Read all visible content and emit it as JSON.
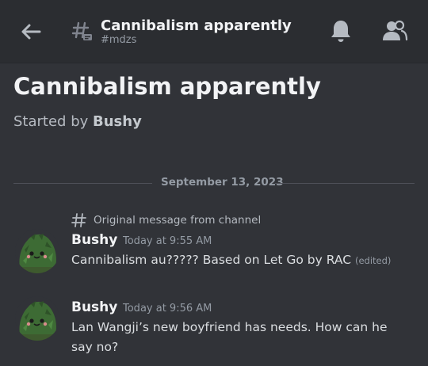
{
  "header": {
    "title": "Cannibalism apparently",
    "channel": "#mdzs",
    "icons": [
      "back-arrow-icon",
      "thread-icon",
      "bell-icon",
      "members-icon"
    ]
  },
  "thread": {
    "title": "Cannibalism apparently",
    "started_prefix": "Started by",
    "started_by": "Bushy"
  },
  "divider": {
    "date": "September 13, 2023"
  },
  "original_label": "Original message from channel",
  "messages": [
    {
      "author": "Bushy",
      "time": "Today at 9:55 AM",
      "text": "Cannibalism au????? Based on Let Go by RAC",
      "edited": "(edited)"
    },
    {
      "author": "Bushy",
      "time": "Today at 9:56 AM",
      "text": "Lan Wangji’s new boyfriend has needs. How can he say no?"
    }
  ],
  "colors": {
    "background": "#313338",
    "header_bg": "#2b2d31",
    "text_primary": "#f2f3f5",
    "text_muted": "#949ba4",
    "avatar_green": "#3d6b34"
  }
}
